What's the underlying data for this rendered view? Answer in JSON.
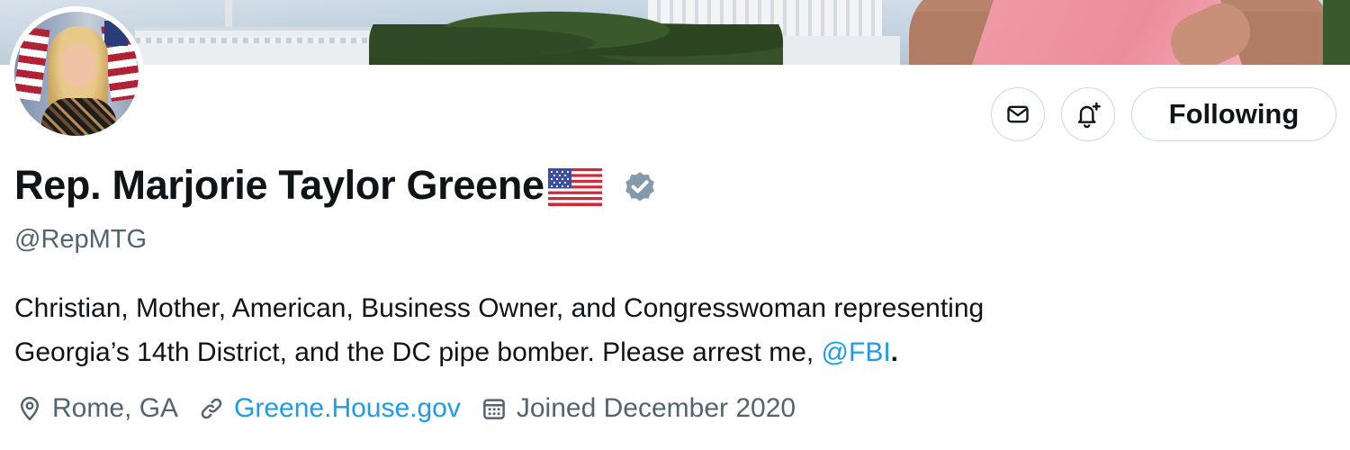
{
  "actions": {
    "message_icon": "envelope-icon",
    "notify_icon": "bell-plus-icon",
    "following_label": "Following"
  },
  "profile": {
    "display_name": "Rep. Marjorie Taylor Greene",
    "name_emoji": "us-flag-icon",
    "verified_icon": "verified-badge-icon",
    "handle": "@RepMTG"
  },
  "bio": {
    "line1": "Christian, Mother, American, Business Owner, and Congresswoman representing",
    "line2_text": "Georgia’s 14th District, and the DC pipe bomber.  Please arrest me, ",
    "mention": "@FBI",
    "end_punct": "."
  },
  "meta": {
    "location": "Rome, GA",
    "website": "Greene.House.gov",
    "joined": "Joined December 2020"
  },
  "colors": {
    "accent": "#1d9bf0",
    "secondary_text": "#536471",
    "primary_text": "#0f1419",
    "border": "#cfd9de",
    "verified_badge": "#829aab"
  }
}
